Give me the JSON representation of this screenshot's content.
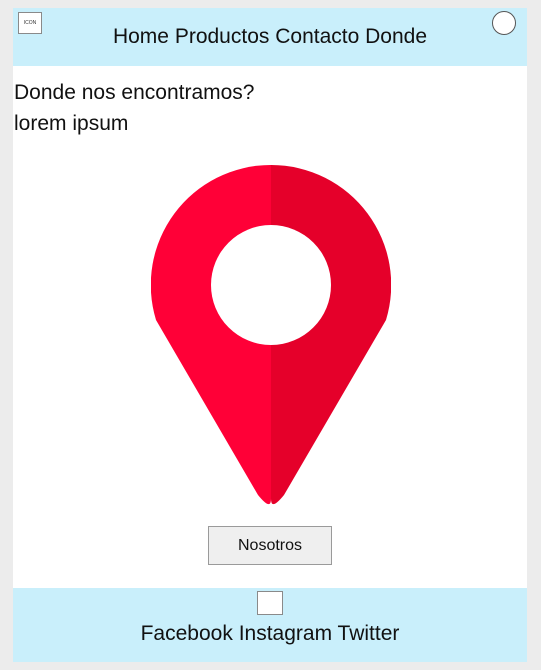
{
  "header": {
    "logo_label": "ICON",
    "nav": [
      {
        "label": "Home"
      },
      {
        "label": "Productos"
      },
      {
        "label": "Contacto"
      },
      {
        "label": "Donde"
      }
    ]
  },
  "main": {
    "heading": "Donde nos encontramos?",
    "subtext": "lorem ipsum",
    "pin_icon": "map-pin-icon",
    "button_label": "Nosotros"
  },
  "footer": {
    "links": [
      {
        "label": "Facebook"
      },
      {
        "label": "Instagram"
      },
      {
        "label": "Twitter"
      }
    ]
  },
  "colors": {
    "header_bg": "#c9effb",
    "pin_left": "#ff0037",
    "pin_right": "#e5002a"
  }
}
